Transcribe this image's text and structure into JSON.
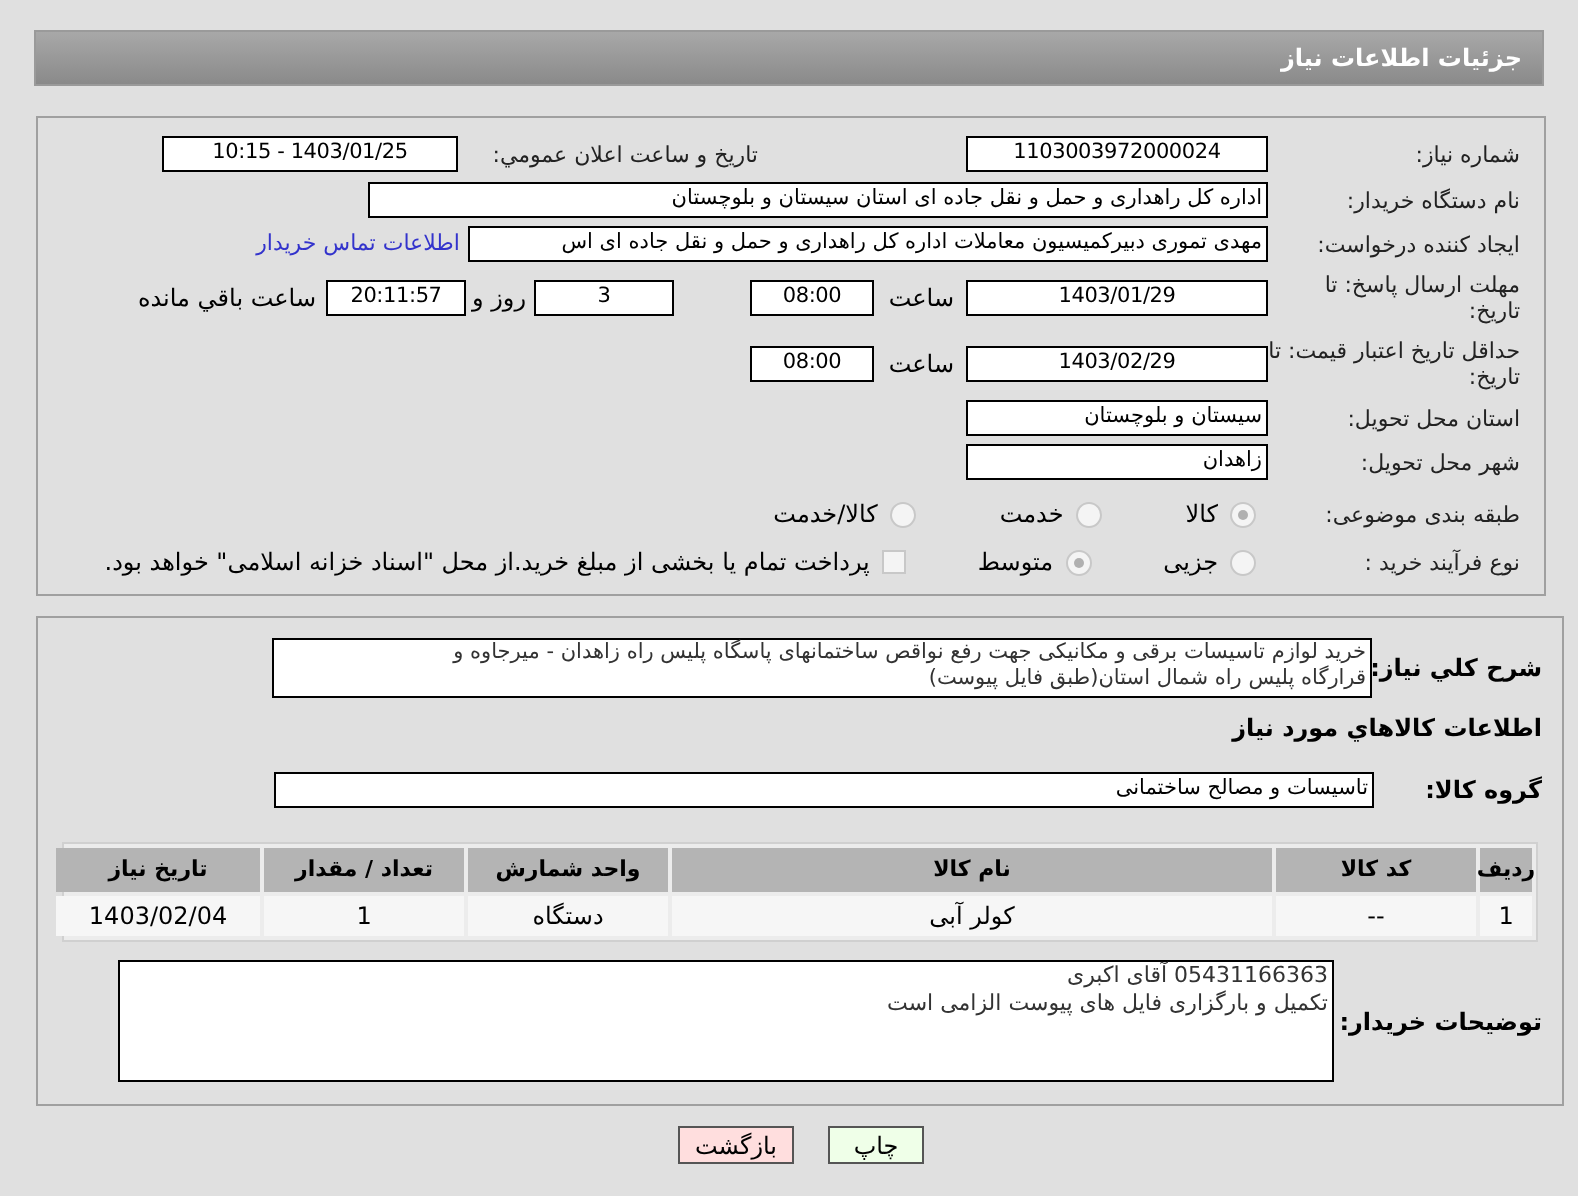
{
  "header": {
    "title": "جزئیات اطلاعات نیاز"
  },
  "need_number": {
    "label": "شماره نیاز:",
    "value": "1103003972000024"
  },
  "announce": {
    "label": "تاریخ و ساعت اعلان عمومي:",
    "value": "1403/01/25 - 10:15"
  },
  "buyer_org": {
    "label": "نام دستگاه خریدار:",
    "value": "اداره کل راهداری و حمل و نقل جاده ای استان سیستان و بلوچستان"
  },
  "requester": {
    "label": "ایجاد کننده درخواست:",
    "value": "مهدی تموری دبیرکمیسیون معاملات اداره کل راهداری و حمل و نقل جاده ای اس",
    "link": "اطلاعات تماس خریدار"
  },
  "reply_deadline": {
    "label": "مهلت ارسال پاسخ: تا تاریخ:",
    "date": "1403/01/29",
    "time_label": "ساعت",
    "time": "08:00",
    "days": "3",
    "days_label": "روز و",
    "remaining": "20:11:57",
    "remaining_label": "ساعت باقي مانده"
  },
  "price_validity": {
    "label": "حداقل تاریخ اعتبار قیمت: تا تاریخ:",
    "date": "1403/02/29",
    "time_label": "ساعت",
    "time": "08:00"
  },
  "province": {
    "label": "استان محل تحویل:",
    "value": "سیستان و بلوچستان"
  },
  "city": {
    "label": "شهر محل تحویل:",
    "value": "زاهدان"
  },
  "category": {
    "label": "طبقه بندی موضوعی:",
    "options": [
      {
        "label": "کالا",
        "selected": true
      },
      {
        "label": "خدمت",
        "selected": false
      },
      {
        "label": "کالا/خدمت",
        "selected": false
      }
    ]
  },
  "purchase_type": {
    "label": "نوع فرآیند خرید :",
    "options": [
      {
        "label": "جزیی",
        "selected": false
      },
      {
        "label": "متوسط",
        "selected": true
      }
    ],
    "payment": {
      "label": "پرداخت تمام یا بخشی از مبلغ خرید.از محل \"اسناد خزانه اسلامی\" خواهد بود.",
      "checked": false
    }
  },
  "description": {
    "label": "شرح کلي نیاز:",
    "lines": [
      "خرید لوازم تاسیسات برقی و مکانیکی جهت رفع نواقص ساختمانهای پاسگاه پلیس راه زاهدان - میرجاوه و",
      "قرارگاه پلیس راه شمال استان(طبق فایل پیوست)"
    ]
  },
  "goods_heading": "اطلاعات کالاهاي مورد نیاز",
  "goods_group": {
    "label": "گروه کالا:",
    "value": "تاسیسات و مصالح ساختمانی"
  },
  "table": {
    "columns": [
      "ردیف",
      "کد کالا",
      "نام کالا",
      "واحد شمارش",
      "تعداد / مقدار",
      "تاریخ نیاز"
    ],
    "rows": [
      [
        "1",
        "--",
        "کولر آبی",
        "دستگاه",
        "1",
        "1403/02/04"
      ]
    ]
  },
  "buyer_notes": {
    "label": "توضیحات خریدار:",
    "lines": [
      "05431166363 آقای اکبری",
      "تکمیل و بارگزاری فایل های پیوست الزامی است"
    ]
  },
  "buttons": [
    {
      "label": "چاپ",
      "kind": "print"
    },
    {
      "label": "بازگشت",
      "kind": "back"
    }
  ]
}
